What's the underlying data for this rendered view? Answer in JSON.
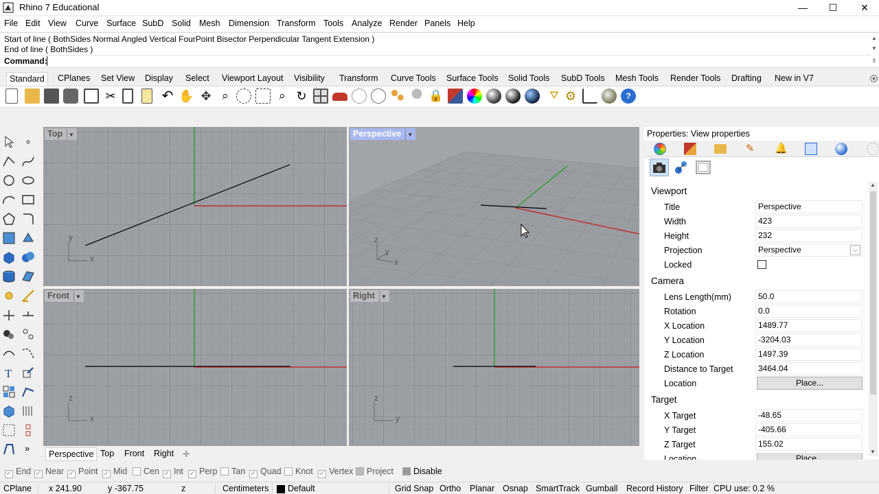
{
  "window": {
    "title": "Rhino 7 Educational",
    "minimize": "—",
    "maximize": "☐",
    "close": "✕"
  },
  "menu": [
    "File",
    "Edit",
    "View",
    "Curve",
    "Surface",
    "SubD",
    "Solid",
    "Mesh",
    "Dimension",
    "Transform",
    "Tools",
    "Analyze",
    "Render",
    "Panels",
    "Help"
  ],
  "command": {
    "history_1": "Start of line ( BothSides  Normal  Angled  Vertical  FourPoint  Bisector  Perpendicular  Tangent  Extension )",
    "history_2": "End of line ( BothSides )",
    "prompt": "Command:",
    "value": ""
  },
  "toolbar_tabs": [
    "Standard",
    "CPlanes",
    "Set View",
    "Display",
    "Select",
    "Viewport Layout",
    "Visibility",
    "Transform",
    "Curve Tools",
    "Surface Tools",
    "Solid Tools",
    "SubD Tools",
    "Mesh Tools",
    "Render Tools",
    "Drafting",
    "New in V7"
  ],
  "toolbar_icons": [
    "new-icon",
    "open-icon",
    "save-icon",
    "print-icon",
    "import-icon",
    "cut-icon",
    "copy-icon",
    "paste-icon",
    "undo-icon",
    "pan-icon",
    "rotate-view-icon",
    "zoom-icon",
    "zoom-window-icon",
    "zoom-extents-icon",
    "zoom-selected-icon",
    "rotate-icon",
    "four-view-icon",
    "car-icon",
    "osnap-icon",
    "circle-icon",
    "point-cloud-icon",
    "light-icon",
    "lock-icon",
    "layer-icon",
    "color-wheel-icon",
    "shaded-icon",
    "rendered-icon",
    "ghosted-icon",
    "material-icon",
    "filter-icon",
    "settings-icon",
    "dimension-icon",
    "render-sphere-icon",
    "help-icon"
  ],
  "viewports": {
    "top": {
      "label": "Top",
      "axis_a": "y",
      "axis_b": "x"
    },
    "perspective": {
      "label": "Perspective",
      "axis_z": "z",
      "axis_a": "y",
      "axis_b": "x"
    },
    "front": {
      "label": "Front",
      "axis_a": "z",
      "axis_b": "x"
    },
    "right": {
      "label": "Right",
      "axis_a": "z",
      "axis_b": "y"
    }
  },
  "viewport_tabs": [
    "Perspective",
    "Top",
    "Front",
    "Right"
  ],
  "properties": {
    "header": "Properties: View properties",
    "viewport_section": "Viewport",
    "camera_section": "Camera",
    "target_section": "Target",
    "rows": {
      "title": {
        "label": "Title",
        "value": "Perspective"
      },
      "width": {
        "label": "Width",
        "value": "423"
      },
      "height": {
        "label": "Height",
        "value": "232"
      },
      "projection": {
        "label": "Projection",
        "value": "Perspective"
      },
      "locked": {
        "label": "Locked"
      },
      "lens": {
        "label": "Lens Length(mm)",
        "value": "50.0"
      },
      "rotation": {
        "label": "Rotation",
        "value": "0.0"
      },
      "xloc": {
        "label": "X Location",
        "value": "1489.77"
      },
      "yloc": {
        "label": "Y Location",
        "value": "-3204.03"
      },
      "zloc": {
        "label": "Z Location",
        "value": "1497.39"
      },
      "dist": {
        "label": "Distance to Target",
        "value": "3464.04"
      },
      "location": {
        "label": "Location",
        "button": "Place..."
      },
      "xtarget": {
        "label": "X Target",
        "value": "-48.65"
      },
      "ytarget": {
        "label": "Y Target",
        "value": "-405.66"
      },
      "ztarget": {
        "label": "Z Target",
        "value": "155.02"
      },
      "location2": {
        "label": "Location",
        "button": "Place..."
      }
    }
  },
  "osnaps": [
    {
      "label": "End",
      "checked": true
    },
    {
      "label": "Near",
      "checked": true
    },
    {
      "label": "Point",
      "checked": true
    },
    {
      "label": "Mid",
      "checked": true
    },
    {
      "label": "Cen",
      "checked": false
    },
    {
      "label": "Int",
      "checked": true
    },
    {
      "label": "Perp",
      "checked": true
    },
    {
      "label": "Tan",
      "checked": false
    },
    {
      "label": "Quad",
      "checked": true
    },
    {
      "label": "Knot",
      "checked": false
    },
    {
      "label": "Vertex",
      "checked": true
    },
    {
      "label": "Project",
      "checked": false
    },
    {
      "label": "Disable",
      "checked": false
    }
  ],
  "status": {
    "cplane": "CPlane",
    "x": "x 241.90",
    "y": "y -367.75",
    "z": "z",
    "units": "Centimeters",
    "layer": "Default",
    "grid_snap": "Grid Snap",
    "ortho": "Ortho",
    "planar": "Planar",
    "osnap": "Osnap",
    "smarttrack": "SmartTrack",
    "gumball": "Gumball",
    "record_history": "Record History",
    "filter": "Filter",
    "cpu": "CPU use: 0.2 %"
  }
}
